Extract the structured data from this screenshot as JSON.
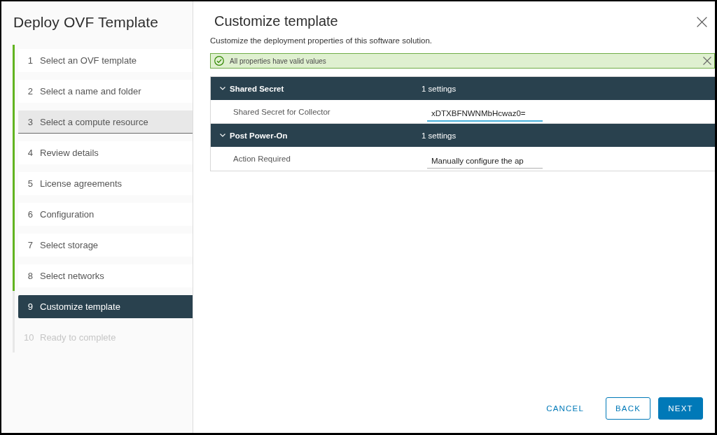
{
  "sidebar": {
    "title": "Deploy OVF Template",
    "steps": [
      {
        "number": "1",
        "label": "Select an OVF template",
        "completed": true,
        "selected": false,
        "hovered": false,
        "disabled": false
      },
      {
        "number": "2",
        "label": "Select a name and folder",
        "completed": true,
        "selected": false,
        "hovered": false,
        "disabled": false
      },
      {
        "number": "3",
        "label": "Select a compute resource",
        "completed": true,
        "selected": false,
        "hovered": true,
        "disabled": false
      },
      {
        "number": "4",
        "label": "Review details",
        "completed": true,
        "selected": false,
        "hovered": false,
        "disabled": false
      },
      {
        "number": "5",
        "label": "License agreements",
        "completed": true,
        "selected": false,
        "hovered": false,
        "disabled": false
      },
      {
        "number": "6",
        "label": "Configuration",
        "completed": true,
        "selected": false,
        "hovered": false,
        "disabled": false
      },
      {
        "number": "7",
        "label": "Select storage",
        "completed": true,
        "selected": false,
        "hovered": false,
        "disabled": false
      },
      {
        "number": "8",
        "label": "Select networks",
        "completed": true,
        "selected": false,
        "hovered": false,
        "disabled": false
      },
      {
        "number": "9",
        "label": "Customize template",
        "completed": false,
        "selected": true,
        "hovered": false,
        "disabled": false
      },
      {
        "number": "10",
        "label": "Ready to complete",
        "completed": false,
        "selected": false,
        "hovered": false,
        "disabled": true
      }
    ]
  },
  "content": {
    "title": "Customize template",
    "description": "Customize the deployment properties of this software solution.",
    "alert": {
      "message": "All properties have valid values"
    },
    "groups": [
      {
        "title": "Shared Secret",
        "count": "1 settings",
        "expanded": true,
        "properties": [
          {
            "label": "Shared Secret for Collector",
            "value": "xDTXBFNWNMbHcwaz0=",
            "focused": true
          }
        ]
      },
      {
        "title": "Post Power-On",
        "count": "1 settings",
        "expanded": true,
        "properties": [
          {
            "label": "Action Required",
            "value": "Manually configure the ap",
            "focused": false
          }
        ]
      }
    ]
  },
  "buttons": [
    {
      "label": "CANCEL",
      "kind": "link"
    },
    {
      "label": "BACK",
      "kind": "outline"
    },
    {
      "label": "NEXT",
      "kind": "primary"
    }
  ]
}
